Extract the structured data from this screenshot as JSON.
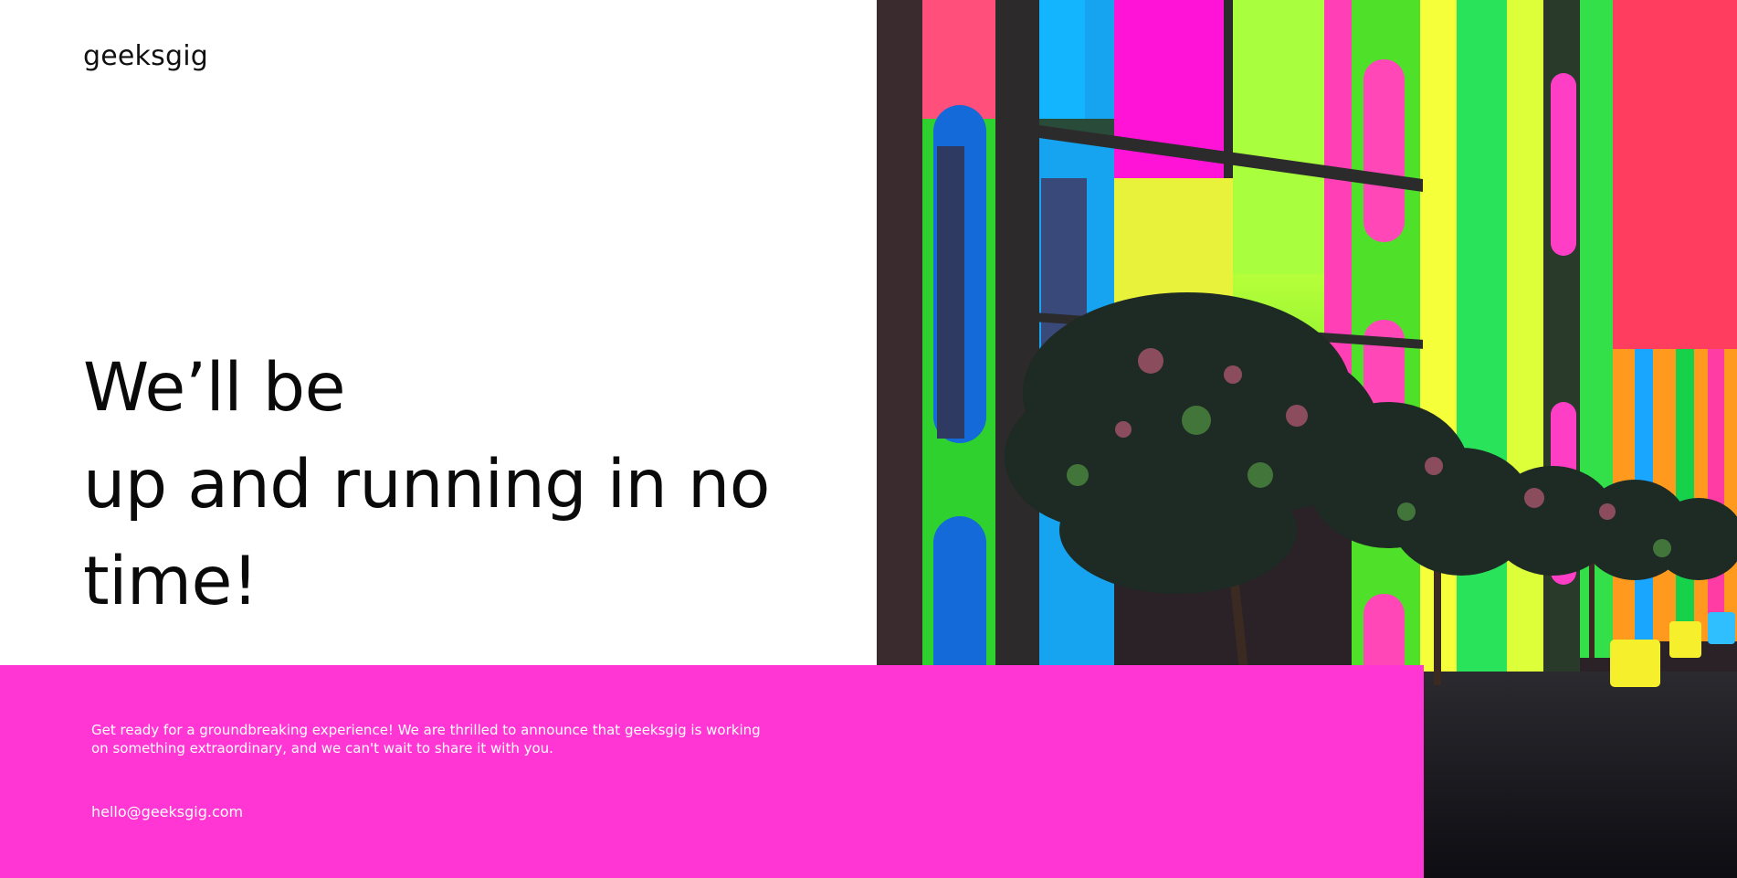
{
  "brand": {
    "logo_text": "geeksgig"
  },
  "hero": {
    "headline_lines": [
      "We’ll be",
      "up and running in no",
      "time!"
    ]
  },
  "panel": {
    "description": "Get ready for a groundbreaking experience! We are thrilled to announce that geeksgig is working on something extraordinary, and we can't wait to share it with you.",
    "email": "hello@geeksgig.com"
  },
  "colors": {
    "accent_pink": "#ff36d4",
    "accent_red": "#ff3d5f",
    "text_dark": "#0a0a0a",
    "background": "#ffffff"
  }
}
